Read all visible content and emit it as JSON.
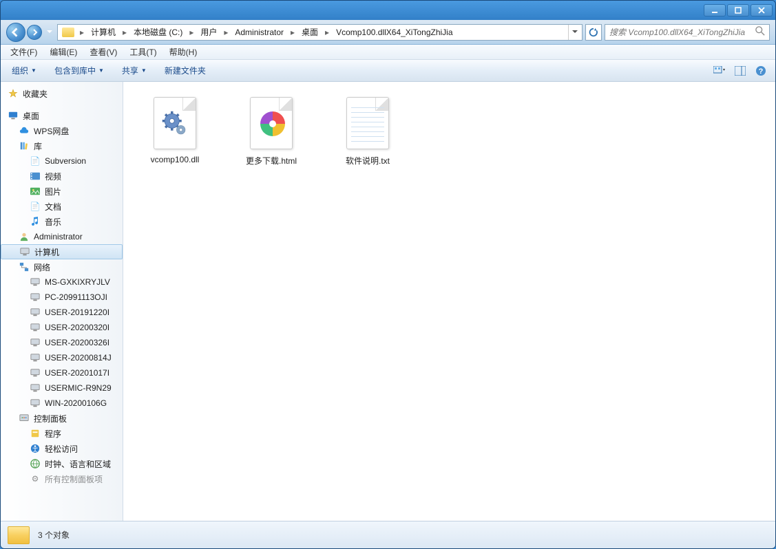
{
  "breadcrumbs": [
    "计算机",
    "本地磁盘 (C:)",
    "用户",
    "Administrator",
    "桌面",
    "Vcomp100.dllX64_XiTongZhiJia"
  ],
  "search_placeholder": "搜索 Vcomp100.dllX64_XiTongZhiJia",
  "menu": {
    "file": "文件(F)",
    "edit": "编辑(E)",
    "view": "查看(V)",
    "tools": "工具(T)",
    "help": "帮助(H)"
  },
  "toolbar": {
    "organize": "组织",
    "include": "包含到库中",
    "share": "共享",
    "newfolder": "新建文件夹"
  },
  "sidebar": {
    "favorites": "收藏夹",
    "desktop": "桌面",
    "wps": "WPS网盘",
    "libraries": "库",
    "subversion": "Subversion",
    "videos": "视频",
    "pictures": "图片",
    "documents": "文档",
    "music": "音乐",
    "admin": "Administrator",
    "computer": "计算机",
    "network": "网络",
    "net_items": [
      "MS-GXKIXRYJLV",
      "PC-20991113OJI",
      "USER-20191220I",
      "USER-20200320I",
      "USER-20200326I",
      "USER-20200814J",
      "USER-20201017I",
      "USERMIC-R9N29",
      "WIN-20200106G"
    ],
    "controlpanel": "控制面板",
    "programs": "程序",
    "ease": "轻松访问",
    "clock": "时钟、语言和区域",
    "truncated": "所有控制面板项"
  },
  "files": [
    {
      "name": "vcomp100.dll",
      "type": "dll"
    },
    {
      "name": "更多下载.html",
      "type": "html"
    },
    {
      "name": "软件说明.txt",
      "type": "txt"
    }
  ],
  "status": {
    "count": "3 个对象"
  }
}
